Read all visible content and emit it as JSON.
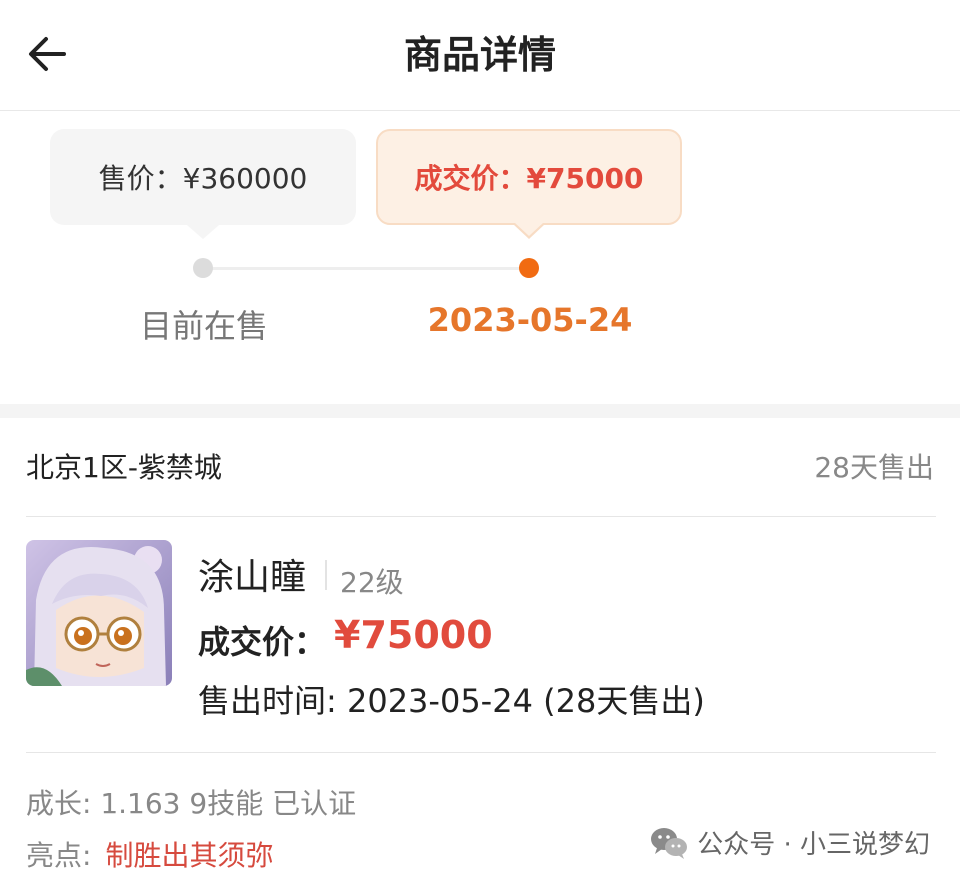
{
  "header": {
    "title": "商品详情",
    "back_icon": "arrow-left-icon"
  },
  "timeline": {
    "current": {
      "bubble_label": "售价：¥360000",
      "label": "目前在售"
    },
    "deal": {
      "bubble_label": "成交价：¥75000",
      "date": "2023-05-24"
    }
  },
  "item": {
    "server": "北京1区-紫禁城",
    "sold_after": "28天售出",
    "character": {
      "name": "涂山瞳",
      "level": "22级",
      "price_label": "成交价：",
      "price": "¥75000",
      "sold_time_label": "售出时间:",
      "sold_time_value": "2023-05-24 (28天售出)"
    },
    "growth": "成长: 1.163 9技能 已认证",
    "highlight_label": "亮点:",
    "highlight_value": "制胜出其须弥"
  },
  "watermark": {
    "icon": "wechat-icon",
    "text": "公众号 · 小三说梦幻"
  },
  "colors": {
    "accent_orange": "#f16b12",
    "price_red": "#e14b3d",
    "bubble_orange_bg": "#fdf0e4"
  }
}
